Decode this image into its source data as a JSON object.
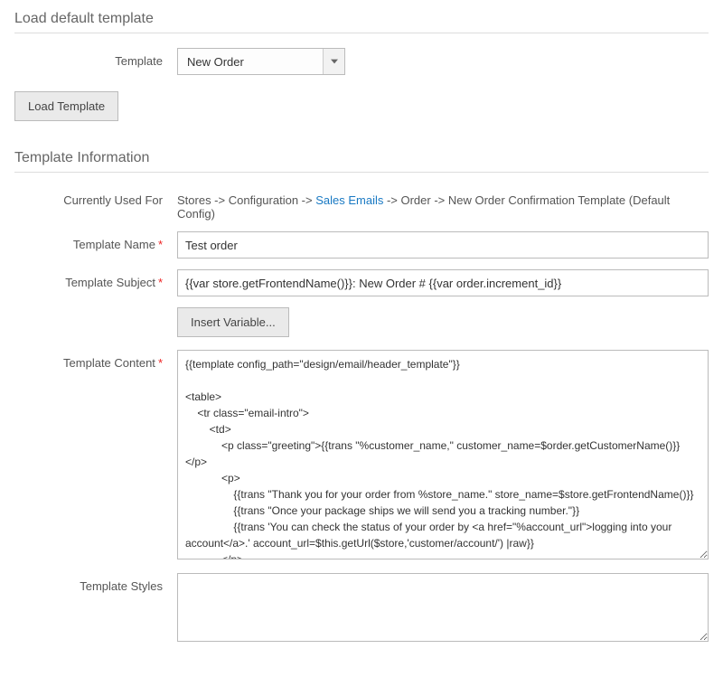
{
  "section1": {
    "title": "Load default template",
    "template_label": "Template",
    "template_selected": "New Order",
    "load_button": "Load Template"
  },
  "section2": {
    "title": "Template Information",
    "used_for_label": "Currently Used For",
    "used_for_prefix": "Stores -> Configuration -> ",
    "used_for_link": "Sales Emails",
    "used_for_suffix": " -> Order -> New Order Confirmation Template  (Default Config)",
    "name_label": "Template Name",
    "name_value": "Test order",
    "subject_label": "Template Subject",
    "subject_value": "{{var store.getFrontendName()}}: New Order # {{var order.increment_id}}",
    "insert_variable": "Insert Variable...",
    "content_label": "Template Content",
    "content_value": "{{template config_path=\"design/email/header_template\"}}\n\n<table>\n    <tr class=\"email-intro\">\n        <td>\n            <p class=\"greeting\">{{trans \"%customer_name,\" customer_name=$order.getCustomerName()}}</p>\n            <p>\n                {{trans \"Thank you for your order from %store_name.\" store_name=$store.getFrontendName()}}\n                {{trans \"Once your package ships we will send you a tracking number.\"}}\n                {{trans 'You can check the status of your order by <a href=\"%account_url\">logging into your account</a>.' account_url=$this.getUrl($store,'customer/account/') |raw}}\n            </p>\n            <p>\n                {{trans 'If you have questions about your order, you can email us at <a href=\"mailto:%store_email\">%store_email</a>' store_email=$store_email |raw}}{{depend store_phone}} {{trans 'or call us at <a href=\"tel:%store_phone\">%store_phone</a>' store_phone=$store_phone |raw}}{{/depend}}.\n                {{depend store_hours}}\n                    {{trans 'Our hours are <span class=\"no-link\">%store_hours</span>.' store_hours=$store_hours |raw}}\n                {{/depend}}\n            </p>\n        </td>",
    "styles_label": "Template Styles",
    "styles_value": ""
  }
}
